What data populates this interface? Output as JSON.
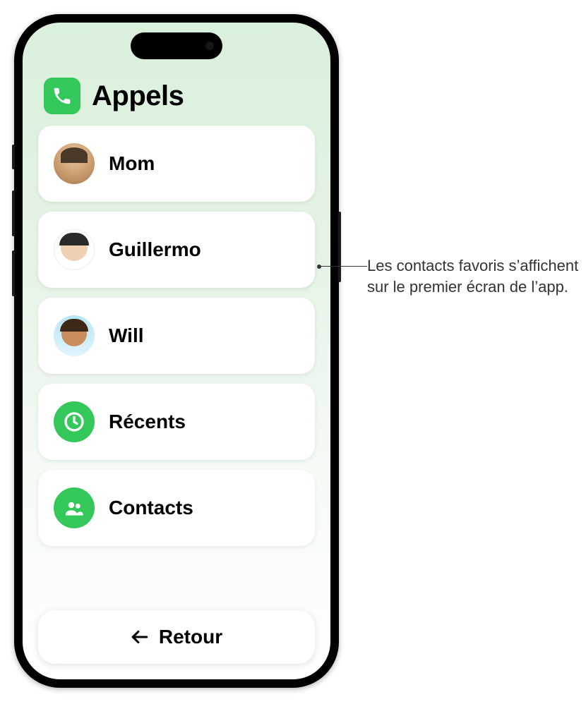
{
  "header": {
    "app_title": "Appels",
    "icon_name": "phone-icon"
  },
  "contacts": [
    {
      "name": "Mom",
      "avatar": "mom"
    },
    {
      "name": "Guillermo",
      "avatar": "guillermo"
    },
    {
      "name": "Will",
      "avatar": "will"
    }
  ],
  "menu": {
    "recents_label": "Récents",
    "contacts_label": "Contacts"
  },
  "footer": {
    "back_label": "Retour"
  },
  "callout": {
    "text": "Les contacts favoris s’affichent sur le premier écran de l’app."
  }
}
